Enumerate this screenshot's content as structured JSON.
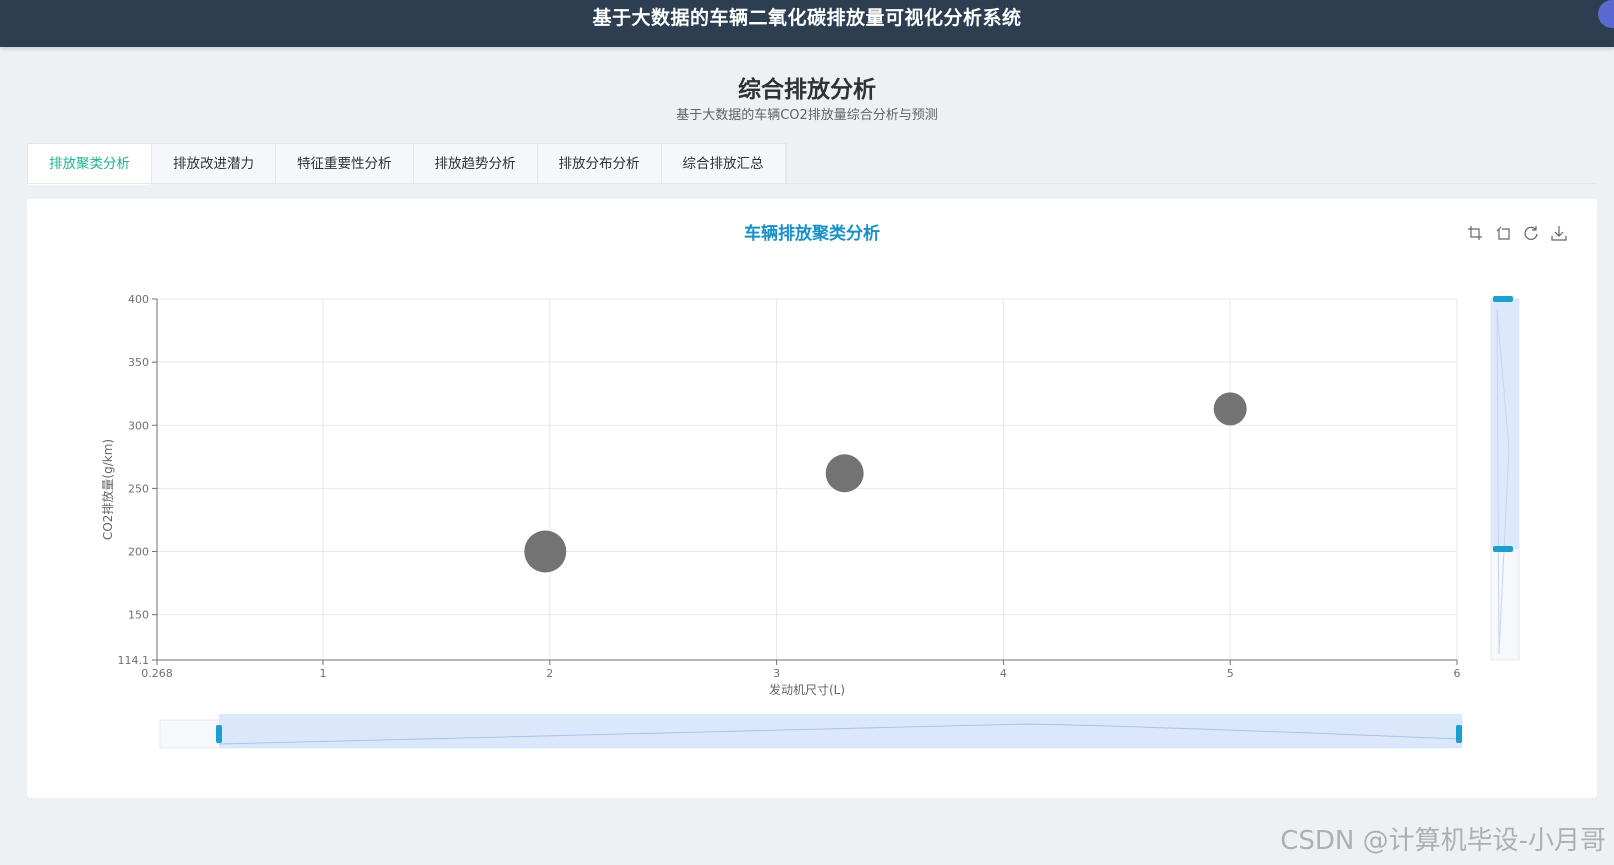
{
  "header": {
    "title": "基于大数据的车辆二氧化碳排放量可视化分析系统"
  },
  "page": {
    "title": "综合排放分析",
    "subtitle": "基于大数据的车辆CO2排放量综合分析与预测"
  },
  "tabs": [
    {
      "label": "排放聚类分析",
      "active": true
    },
    {
      "label": "排放改进潜力",
      "active": false
    },
    {
      "label": "特征重要性分析",
      "active": false
    },
    {
      "label": "排放趋势分析",
      "active": false
    },
    {
      "label": "排放分布分析",
      "active": false
    },
    {
      "label": "综合排放汇总",
      "active": false
    }
  ],
  "toolbox": [
    "zoom-area-icon",
    "zoom-reset-icon",
    "restore-icon",
    "save-image-icon"
  ],
  "chart_data": {
    "type": "scatter",
    "title": "车辆排放聚类分析",
    "xlabel": "发动机尺寸(L)",
    "ylabel": "CO2排放量(g/km)",
    "xlim": [
      0.268,
      6
    ],
    "ylim": [
      114.1,
      400
    ],
    "x_ticks": [
      "0.268",
      "1",
      "2",
      "3",
      "4",
      "5",
      "6"
    ],
    "y_ticks": [
      "114.1",
      "150",
      "200",
      "250",
      "300",
      "350",
      "400"
    ],
    "x_tick_values": [
      0.268,
      1,
      2,
      3,
      4,
      5,
      6
    ],
    "y_tick_values": [
      114.1,
      150,
      200,
      250,
      300,
      350,
      400
    ],
    "grid": true,
    "points": [
      {
        "x": 1.98,
        "y": 200,
        "size": 42
      },
      {
        "x": 3.3,
        "y": 262,
        "size": 38
      },
      {
        "x": 5.0,
        "y": 313,
        "size": 33
      }
    ],
    "point_color": "#6b6b6b",
    "accent_color": "#1a9fce",
    "datazoom": {
      "x": [
        0.05,
        1.0
      ],
      "y": [
        0.3,
        1.0
      ]
    }
  },
  "watermark": "CSDN @计算机毕设-小月哥"
}
